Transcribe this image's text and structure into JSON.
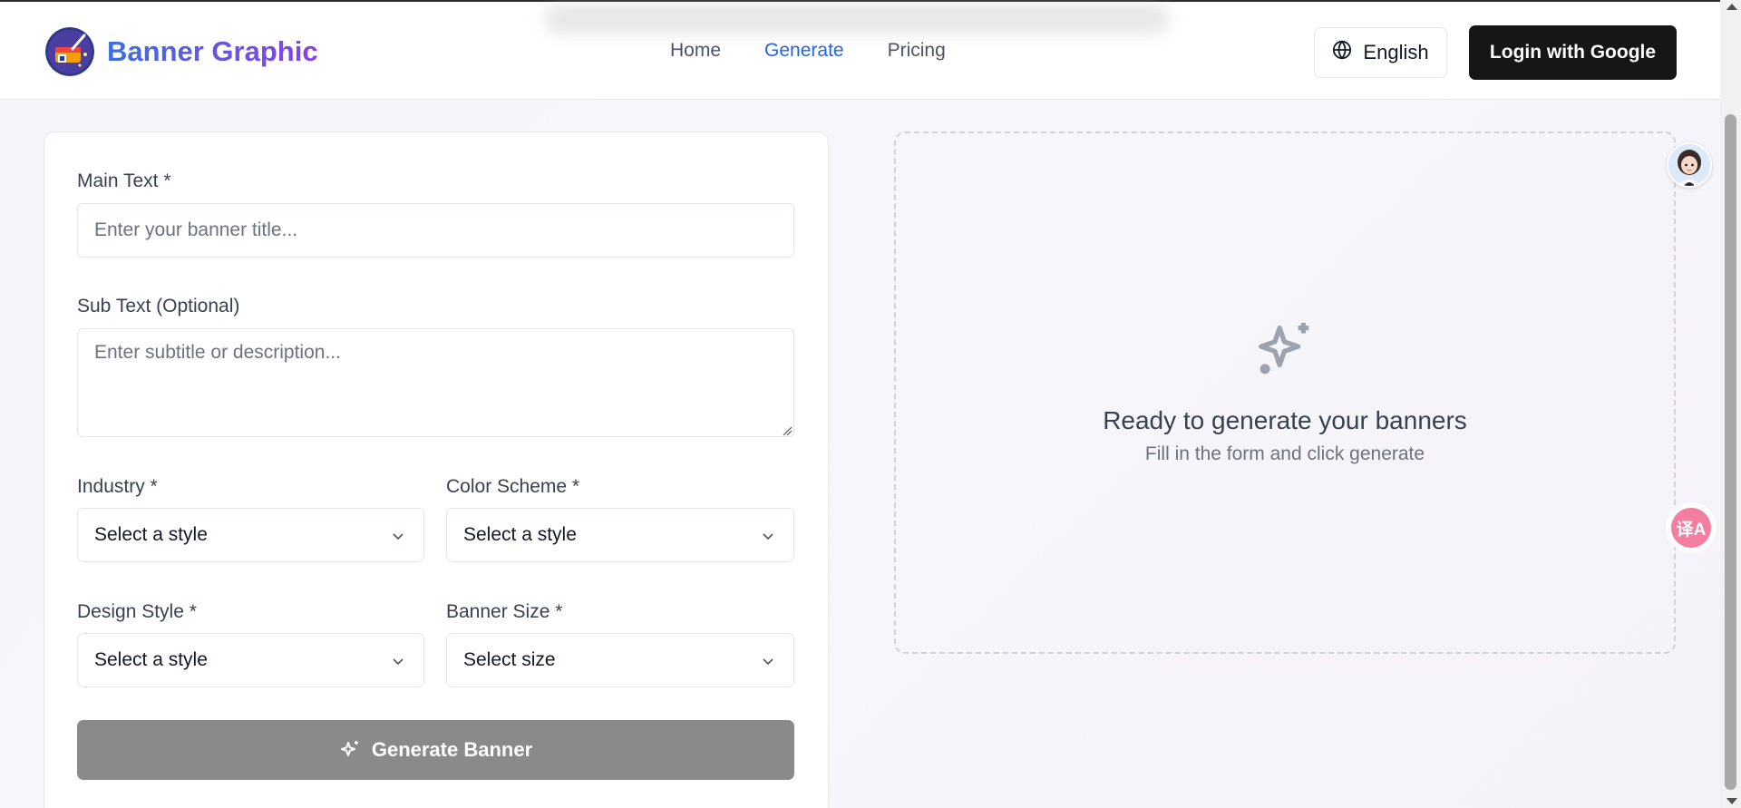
{
  "header": {
    "brand": "Banner Graphic",
    "nav": [
      {
        "label": "Home"
      },
      {
        "label": "Generate"
      },
      {
        "label": "Pricing"
      }
    ],
    "language_label": "English",
    "login_label": "Login with Google"
  },
  "form": {
    "main_text_label": "Main Text *",
    "main_text_placeholder": "Enter your banner title...",
    "sub_text_label": "Sub Text (Optional)",
    "sub_text_placeholder": "Enter subtitle or description...",
    "industry_label": "Industry *",
    "industry_value": "Select a style",
    "color_scheme_label": "Color Scheme *",
    "color_scheme_value": "Select a style",
    "design_style_label": "Design Style *",
    "design_style_value": "Select a style",
    "banner_size_label": "Banner Size *",
    "banner_size_value": "Select size",
    "generate_label": "Generate Banner"
  },
  "preview": {
    "title": "Ready to generate your banners",
    "subtitle": "Fill in the form and click generate"
  },
  "floating": {
    "translate_glyph": "译A"
  },
  "colors": {
    "accent": "#2563eb",
    "brand_gradient_start": "#3b6fe0",
    "brand_gradient_end": "#8b3fe6",
    "login_bg": "#161616",
    "generate_bg_disabled": "#8a8a8a",
    "translate_bg": "#f27fa0"
  },
  "icons": {
    "logo": "paint-bucket-logo-icon",
    "language": "globe-icon",
    "dropdown": "chevron-down-icon",
    "generate": "sparkles-icon",
    "preview": "sparkles-icon",
    "avatar": "assistant-avatar-icon",
    "translate": "translate-icon"
  }
}
